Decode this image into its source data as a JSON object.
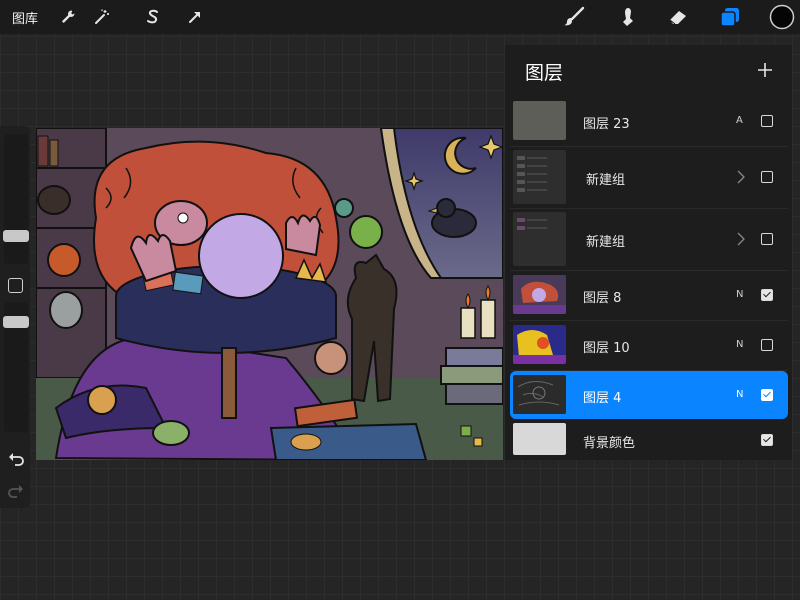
{
  "toolbar": {
    "gallery_label": "图库",
    "left_tools": [
      "wrench-icon",
      "magic-wand-icon",
      "selection-s-icon",
      "arrow-transform-icon"
    ],
    "right_tools": [
      "brush-icon",
      "smudge-icon",
      "eraser-icon",
      "layers-icon"
    ],
    "active_tool": "layers-icon",
    "current_color": "#050505",
    "accent": "#0a84ff"
  },
  "sidebar": {
    "brush_size_level": 0.3,
    "opacity_level": 0.3
  },
  "layers_panel": {
    "title": "图层",
    "layers": [
      {
        "name": "图层 23",
        "blend": "A",
        "visible": false,
        "selected": false,
        "type": "layer"
      },
      {
        "name": "新建组",
        "blend": "",
        "visible": false,
        "selected": false,
        "type": "group"
      },
      {
        "name": "新建组",
        "blend": "",
        "visible": false,
        "selected": false,
        "type": "group"
      },
      {
        "name": "图层 8",
        "blend": "N",
        "visible": true,
        "selected": false,
        "type": "layer"
      },
      {
        "name": "图层 10",
        "blend": "N",
        "visible": false,
        "selected": false,
        "type": "layer"
      },
      {
        "name": "图层 4",
        "blend": "N",
        "visible": true,
        "selected": true,
        "type": "layer"
      },
      {
        "name": "背景颜色",
        "blend": "",
        "visible": true,
        "selected": false,
        "type": "background"
      }
    ]
  }
}
